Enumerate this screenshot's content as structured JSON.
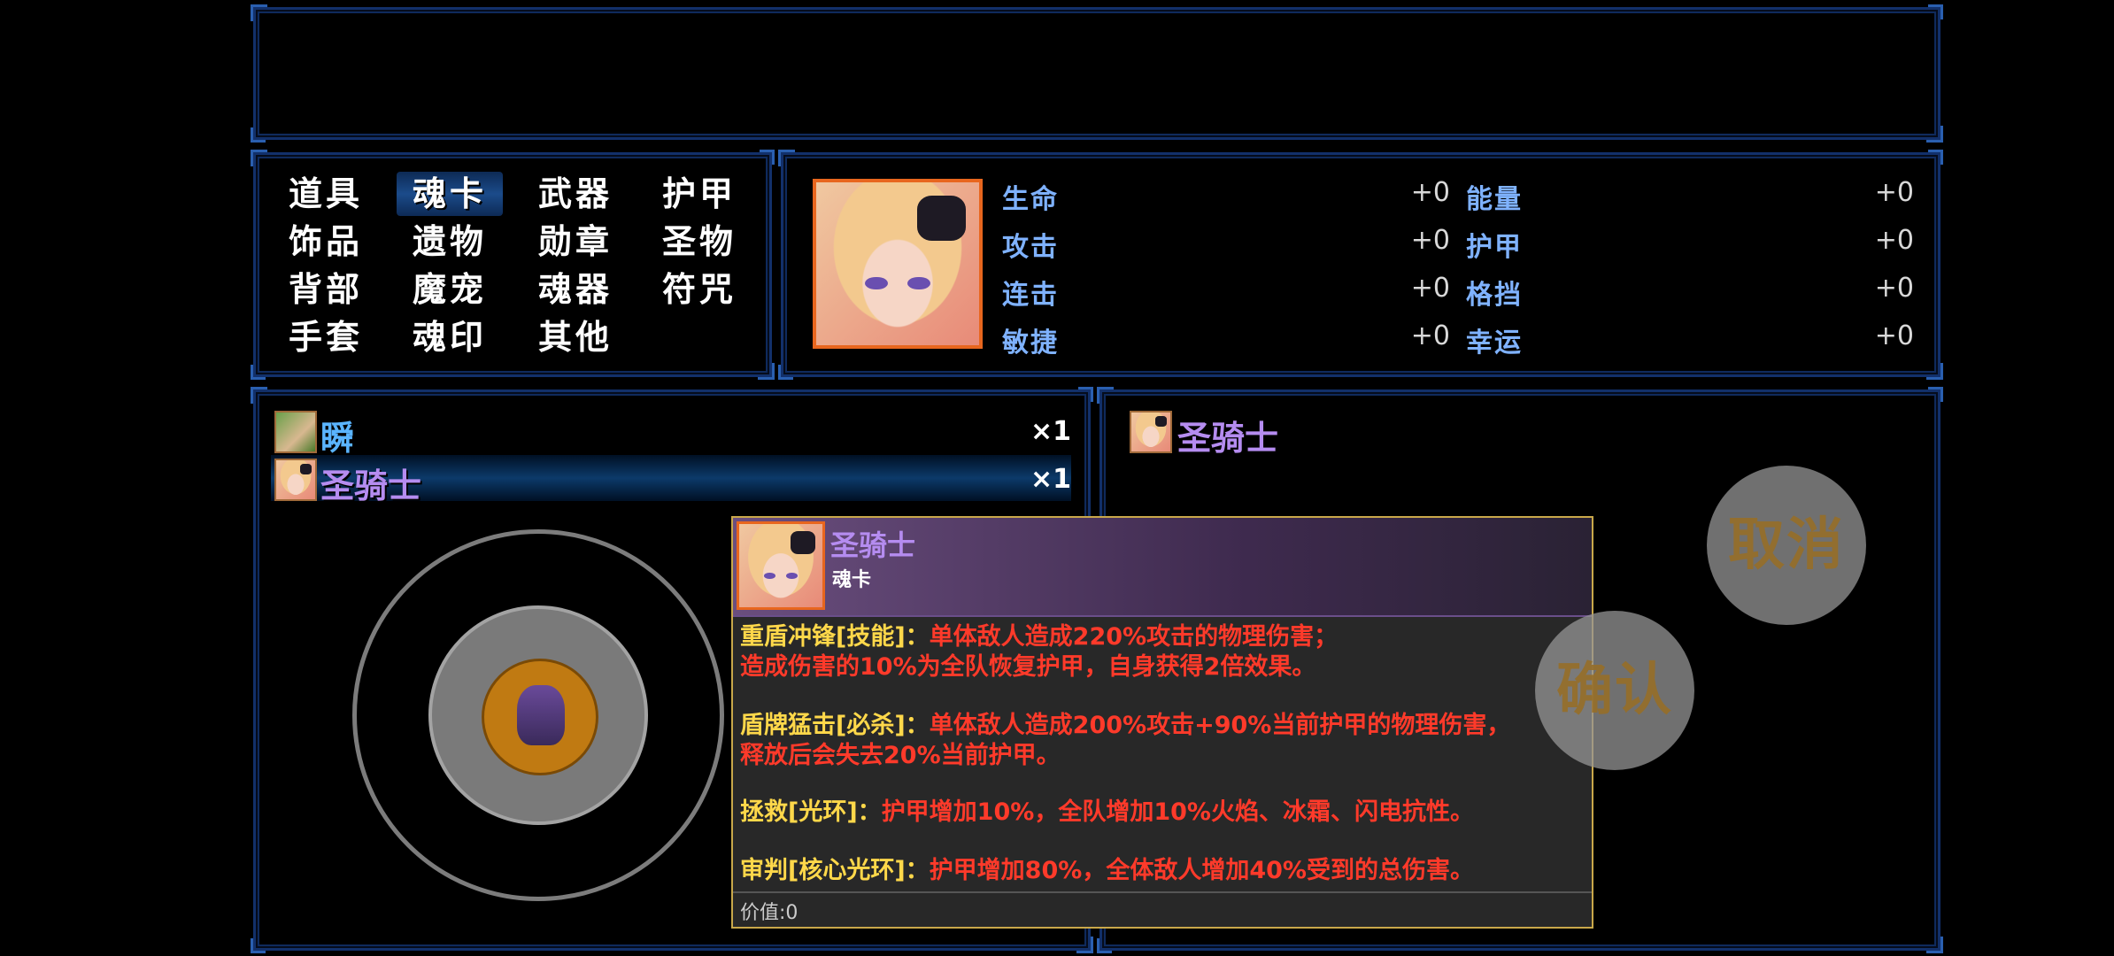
{
  "categories": [
    {
      "label": "道具",
      "selected": false
    },
    {
      "label": "魂卡",
      "selected": true
    },
    {
      "label": "武器",
      "selected": false
    },
    {
      "label": "护甲",
      "selected": false
    },
    {
      "label": "饰品",
      "selected": false
    },
    {
      "label": "遗物",
      "selected": false
    },
    {
      "label": "勋章",
      "selected": false
    },
    {
      "label": "圣物",
      "selected": false
    },
    {
      "label": "背部",
      "selected": false
    },
    {
      "label": "魔宠",
      "selected": false
    },
    {
      "label": "魂器",
      "selected": false
    },
    {
      "label": "符咒",
      "selected": false
    },
    {
      "label": "手套",
      "selected": false
    },
    {
      "label": "魂印",
      "selected": false
    },
    {
      "label": "其他",
      "selected": false
    }
  ],
  "stats": {
    "left": [
      {
        "label": "生命",
        "value": "+0"
      },
      {
        "label": "攻击",
        "value": "+0"
      },
      {
        "label": "连击",
        "value": "+0"
      },
      {
        "label": "敏捷",
        "value": "+0"
      }
    ],
    "right": [
      {
        "label": "能量",
        "value": "+0"
      },
      {
        "label": "护甲",
        "value": "+0"
      },
      {
        "label": "格挡",
        "value": "+0"
      },
      {
        "label": "幸运",
        "value": "+0"
      }
    ]
  },
  "items": [
    {
      "name": "瞬",
      "qty": "×1",
      "color": "#5ab4ff",
      "selected": false,
      "icon": "green-haired-character-icon"
    },
    {
      "name": "圣骑士",
      "qty": "×1",
      "color": "#b58cf0",
      "selected": true,
      "icon": "blonde-knight-portrait-icon"
    }
  ],
  "detail_panel": {
    "name": "圣骑士",
    "color": "#b58cf0"
  },
  "tooltip": {
    "name": "圣骑士",
    "type": "魂卡",
    "skills": [
      {
        "key": "重盾冲锋[技能]：",
        "desc": "单体敌人造成220%攻击的物理伤害；"
      },
      {
        "key": "",
        "desc": "造成伤害的10%为全队恢复护甲，自身获得2倍效果。"
      },
      {
        "key": "盾牌猛击[必杀]：",
        "desc": "单体敌人造成200%攻击+90%当前护甲的物理伤害，"
      },
      {
        "key": "",
        "desc": "释放后会失去20%当前护甲。"
      },
      {
        "key": "拯救[光环]：",
        "desc": "护甲增加10%，全队增加10%火焰、冰霜、闪电抗性。"
      },
      {
        "key": "审判[核心光环]：",
        "desc": "护甲增加80%，全体敌人增加40%受到的总伤害。"
      }
    ],
    "value_label": "价值:0"
  },
  "buttons": {
    "cancel": "取消",
    "confirm": "确认"
  },
  "colors": {
    "frame": "#12306a",
    "accent_orange": "#e8661e",
    "skill_key": "#ffd84a",
    "skill_desc": "#ff3a2a",
    "rare_purple": "#b58cf0",
    "stat_label": "#7fb2ff"
  }
}
